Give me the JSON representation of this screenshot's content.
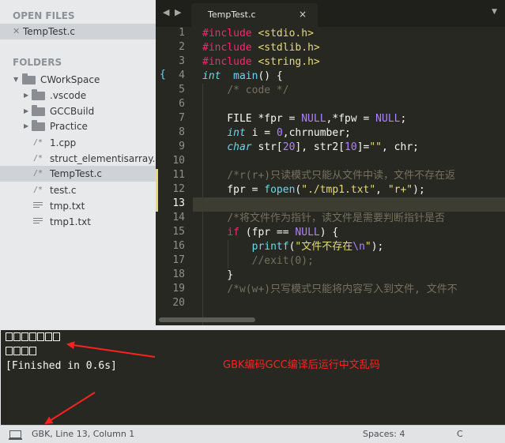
{
  "sidebar": {
    "open_files_header": "OPEN FILES",
    "open_files": [
      {
        "label": "TempTest.c",
        "icon": "close-icon"
      }
    ],
    "folders_header": "FOLDERS",
    "tree": [
      {
        "label": "CWorkSpace",
        "type": "folder",
        "expanded": true
      },
      {
        "label": ".vscode",
        "type": "folder"
      },
      {
        "label": "GCCBuild",
        "type": "folder"
      },
      {
        "label": "Practice",
        "type": "folder"
      },
      {
        "label": "1.cpp",
        "type": "c-file"
      },
      {
        "label": "struct_elementisarray.c",
        "type": "c-file"
      },
      {
        "label": "TempTest.c",
        "type": "c-file",
        "selected": true
      },
      {
        "label": "test.c",
        "type": "c-file"
      },
      {
        "label": "tmp.txt",
        "type": "text-file"
      },
      {
        "label": "tmp1.txt",
        "type": "text-file"
      }
    ],
    "c_icon_glyph": "/*"
  },
  "tabbar": {
    "back_icon": "◀",
    "forward_icon": "▶",
    "tab_title": "TempTest.c",
    "tab_close": "×",
    "dropdown_icon": "▼"
  },
  "editor": {
    "line_numbers": [
      "1",
      "2",
      "3",
      "4",
      "5",
      "6",
      "7",
      "8",
      "9",
      "10",
      "11",
      "12",
      "13",
      "14",
      "15",
      "16",
      "17",
      "18",
      "19",
      "20"
    ],
    "current_line": 13,
    "bracket_marker": "{",
    "code_lines": [
      {
        "n": 1,
        "parts": [
          [
            "kw",
            "#include "
          ],
          [
            "st",
            "<stdio.h>"
          ]
        ]
      },
      {
        "n": 2,
        "parts": [
          [
            "kw",
            "#include "
          ],
          [
            "st",
            "<stdlib.h>"
          ]
        ]
      },
      {
        "n": 3,
        "parts": [
          [
            "kw",
            "#include "
          ],
          [
            "st",
            "<string.h>"
          ]
        ]
      },
      {
        "n": 4,
        "parts": [
          [
            "ty",
            "int"
          ],
          [
            "",
            "  "
          ],
          [
            "fn",
            "main"
          ],
          [
            "",
            "() {"
          ]
        ]
      },
      {
        "n": 5,
        "parts": [
          [
            "",
            "    "
          ],
          [
            "cm",
            "/* code */"
          ]
        ]
      },
      {
        "n": 6,
        "parts": [
          [
            "",
            ""
          ]
        ]
      },
      {
        "n": 7,
        "parts": [
          [
            "",
            "    FILE *fpr = "
          ],
          [
            "nu",
            "NULL"
          ],
          [
            "",
            ",*fpw = "
          ],
          [
            "nu",
            "NULL"
          ],
          [
            "",
            ";"
          ]
        ]
      },
      {
        "n": 8,
        "parts": [
          [
            "",
            "    "
          ],
          [
            "ty",
            "int"
          ],
          [
            "",
            " i = "
          ],
          [
            "nu",
            "0"
          ],
          [
            "",
            ",chrnumber;"
          ]
        ]
      },
      {
        "n": 9,
        "parts": [
          [
            "",
            "    "
          ],
          [
            "ty",
            "char"
          ],
          [
            "",
            " str["
          ],
          [
            "nu",
            "20"
          ],
          [
            "",
            "], str2["
          ],
          [
            "nu",
            "10"
          ],
          [
            "",
            "]="
          ],
          [
            "st",
            "\"\""
          ],
          [
            "",
            ", chr;"
          ]
        ]
      },
      {
        "n": 10,
        "parts": [
          [
            "",
            ""
          ]
        ]
      },
      {
        "n": 11,
        "parts": [
          [
            "",
            "    "
          ],
          [
            "cm",
            "/*r(r+)只读模式只能从文件中读，文件不存在返"
          ]
        ]
      },
      {
        "n": 12,
        "parts": [
          [
            "",
            "    fpr = "
          ],
          [
            "fn",
            "fopen"
          ],
          [
            "",
            "("
          ],
          [
            "st",
            "\"./tmp1.txt\""
          ],
          [
            "",
            ", "
          ],
          [
            "st",
            "\"r+\""
          ],
          [
            "",
            ");"
          ]
        ]
      },
      {
        "n": 13,
        "parts": [
          [
            "",
            ""
          ]
        ]
      },
      {
        "n": 14,
        "parts": [
          [
            "",
            "    "
          ],
          [
            "cm",
            "/*将文件作为指针，读文件是需要判断指针是否"
          ]
        ]
      },
      {
        "n": 15,
        "parts": [
          [
            "",
            "    "
          ],
          [
            "kw",
            "if"
          ],
          [
            "",
            " (fpr == "
          ],
          [
            "nu",
            "NULL"
          ],
          [
            "",
            ") {"
          ]
        ]
      },
      {
        "n": 16,
        "parts": [
          [
            "",
            "        "
          ],
          [
            "fn",
            "printf"
          ],
          [
            "",
            "("
          ],
          [
            "st",
            "\"文件不存在"
          ],
          [
            "nu",
            "\\n"
          ],
          [
            "st",
            "\""
          ],
          [
            "",
            ");"
          ]
        ]
      },
      {
        "n": 17,
        "parts": [
          [
            "",
            "        "
          ],
          [
            "cm",
            "//exit(0);"
          ]
        ]
      },
      {
        "n": 18,
        "parts": [
          [
            "",
            "    }"
          ]
        ]
      },
      {
        "n": 19,
        "parts": [
          [
            "",
            "    "
          ],
          [
            "cm",
            "/*w(w+)只写模式只能将内容写入到文件, 文件不"
          ]
        ]
      },
      {
        "n": 20,
        "parts": [
          [
            "",
            ""
          ]
        ]
      }
    ]
  },
  "console": {
    "garbled_line1_count": 7,
    "garbled_line2_count": 4,
    "finished_text": "[Finished in 0.6s]",
    "annotation": "GBK编码GCC编译后运行中文乱码"
  },
  "status": {
    "encoding_position": "GBK, Line 13, Column 1",
    "indentation": "Spaces: 4",
    "syntax": "C"
  },
  "colors": {
    "background": "#272822",
    "keyword": "#f92672",
    "string": "#e6db74",
    "comment": "#75715e",
    "annotation": "#ff2020"
  }
}
